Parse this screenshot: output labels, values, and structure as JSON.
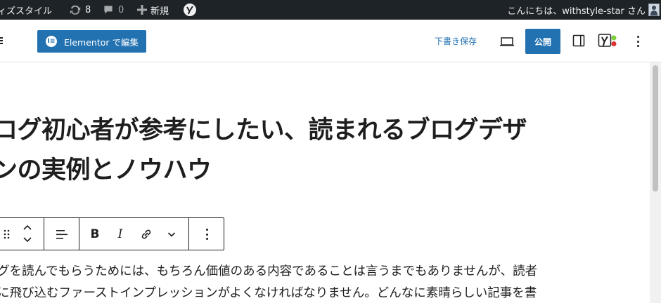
{
  "admin_bar": {
    "site_name": "ィズスタイル",
    "updates_count": "8",
    "comments_count": "0",
    "new_label": "新規",
    "greeting": "こんにちは、withstyle-star さん"
  },
  "header": {
    "elementor_label": "Elementor で編集",
    "save_draft_label": "下書き保存",
    "publish_label": "公開",
    "accent_color": "#2271b1"
  },
  "post": {
    "title_lines": [
      "ログ初心者が参考にしたい、読まれるブログデザ",
      "ンの実例とノウハウ"
    ],
    "paragraph_lines": [
      "グを読んでもらうためには、もちろん価値のある内容であることは言うまでもありませんが、読者",
      "に飛び込むファーストインプレッションがよくなければなりません。どんなに素晴らしい記事を書"
    ]
  },
  "block_toolbar": {
    "bold_label": "B",
    "italic_label": "I"
  },
  "icons": [
    "sync-icon",
    "comment-icon",
    "plus-icon",
    "yoast-icon",
    "avatar",
    "elementor-icon",
    "desktop-preview-icon",
    "sidebar-settings-icon",
    "more-vertical-icon",
    "drag-handle-icon",
    "move-up-icon",
    "move-down-icon",
    "align-left-icon",
    "link-icon",
    "chevron-down-icon"
  ]
}
